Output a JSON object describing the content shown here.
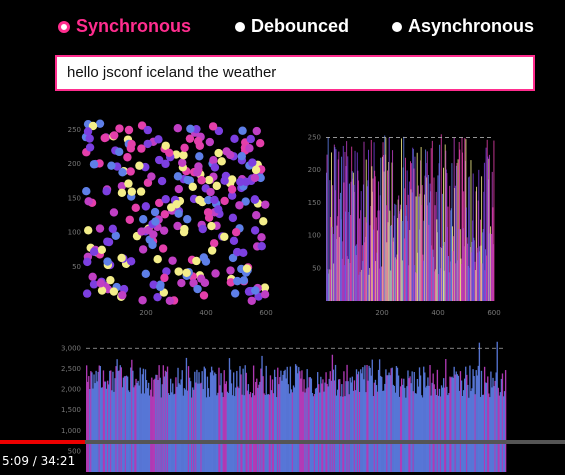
{
  "modes": [
    {
      "label": "Synchronous",
      "active": true
    },
    {
      "label": "Debounced",
      "active": false
    },
    {
      "label": "Asynchronous",
      "active": false
    }
  ],
  "text_input": {
    "value": "hello jsconf iceland the weather"
  },
  "colors": {
    "accent": "#ff2d8e",
    "points": [
      "#c03fc4",
      "#5e7fe8",
      "#f4ee8a",
      "#7c3fe0",
      "#e43faa"
    ]
  },
  "chart_data": [
    {
      "type": "scatter",
      "xlim": [
        0,
        600
      ],
      "ylim": [
        0,
        260
      ],
      "y_ticks": [
        "50",
        "100",
        "150",
        "200",
        "250"
      ],
      "x_ticks": [
        "200",
        "400",
        "600"
      ],
      "point_count": 300
    },
    {
      "type": "bar",
      "xlim": [
        0,
        600
      ],
      "ylim": [
        0,
        260
      ],
      "y_ticks": [
        "50",
        "100",
        "150",
        "200",
        "250"
      ],
      "x_ticks": [
        "200",
        "400",
        "600"
      ],
      "bar_count": 300
    },
    {
      "type": "bar",
      "ylim": [
        0,
        3200
      ],
      "y_ticks": [
        "500",
        "1,000",
        "1,500",
        "2,000",
        "2,500",
        "3,000"
      ],
      "bar_count": 400
    }
  ],
  "video": {
    "time": "5:09 / 34:21",
    "progress": 0.15
  }
}
